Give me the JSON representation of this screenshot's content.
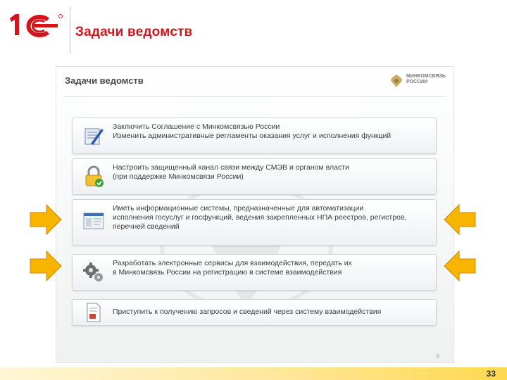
{
  "header": {
    "title": "Задачи ведомств"
  },
  "screenshot": {
    "title": "Задачи ведомств",
    "ministry": {
      "line1": "МИНКОМСВЯЗЬ",
      "line2": "РОССИИ"
    },
    "tasks": [
      {
        "lines": [
          "Заключить Соглашение с Минкомсвязью России",
          "Изменить административные регламенты оказания услуг и исполнения функций"
        ],
        "icon": "document-pen-icon"
      },
      {
        "lines": [
          "Настроить защищенный канал связи между СМЭВ и органом власти",
          "(при поддержке Минкомсвязи России)"
        ],
        "icon": "lock-check-icon"
      },
      {
        "lines": [
          "Иметь информационные системы, предназначенные для автоматизации",
          "исполнения госуслуг и госфункций, ведения закрепленных НПА реестров, регистров,",
          "перечней сведений"
        ],
        "icon": "window-icon"
      },
      {
        "lines": [
          "Разработать электронные сервисы для взаимодействия,  передать их",
          "в Минкомсвязь России на регистрацию в системе взаимодействия"
        ],
        "icon": "gears-icon"
      },
      {
        "lines": [
          "Приступить к получению запросов и сведений через систему взаимодействия"
        ],
        "icon": "document-icon"
      }
    ],
    "page_number": "6"
  },
  "footer": {
    "slide_number": "33"
  },
  "colors": {
    "title": "#d4131b",
    "arrow": "#f7b500",
    "footer": "#ffd84f"
  }
}
